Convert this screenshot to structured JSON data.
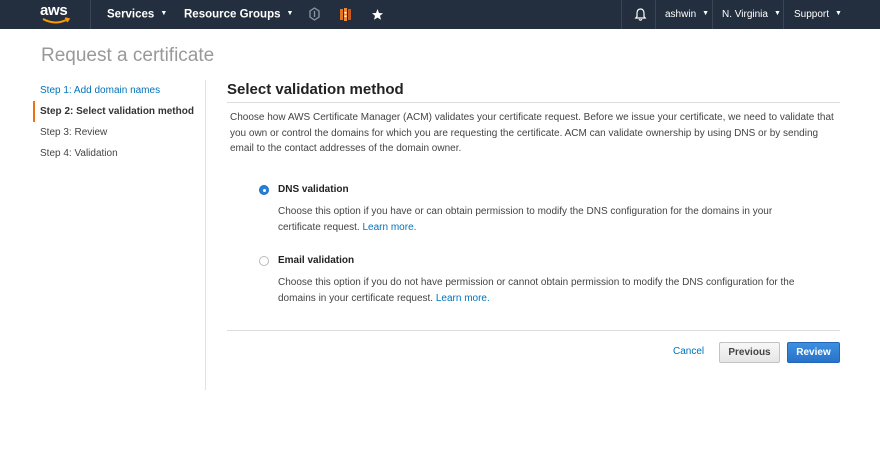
{
  "nav": {
    "logo_text": "aws",
    "services": "Services",
    "resource_groups": "Resource Groups",
    "user": "ashwin",
    "region": "N. Virginia",
    "support": "Support"
  },
  "page": {
    "title": "Request a certificate"
  },
  "steps": [
    {
      "label": "Step 1: Add domain names"
    },
    {
      "label": "Step 2: Select validation method"
    },
    {
      "label": "Step 3: Review"
    },
    {
      "label": "Step 4: Validation"
    }
  ],
  "section": {
    "title": "Select validation method",
    "intro": "Choose how AWS Certificate Manager (ACM) validates your certificate request. Before we issue your certificate, we need to validate that you own or control the domains for which you are requesting the certificate. ACM can validate ownership by using DNS or by sending email to the contact addresses of the domain owner."
  },
  "options": {
    "dns": {
      "label": "DNS validation",
      "desc": "Choose this option if you have or can obtain permission to modify the DNS configuration for the domains in your certificate request.",
      "learn_more": "Learn more.",
      "selected": true
    },
    "email": {
      "label": "Email validation",
      "desc": "Choose this option if you do not have permission or cannot obtain permission to modify the DNS configuration for the domains in your certificate request.",
      "learn_more": "Learn more.",
      "selected": false
    }
  },
  "actions": {
    "cancel": "Cancel",
    "previous": "Previous",
    "review": "Review"
  },
  "colors": {
    "nav_bg": "#232f3e",
    "accent": "#ec7211",
    "link": "#0073bb",
    "primary_button": "#2b7fd6"
  },
  "icons": [
    "pin-icon",
    "cloudformation-icon",
    "bookmark-icon",
    "bell-icon"
  ]
}
